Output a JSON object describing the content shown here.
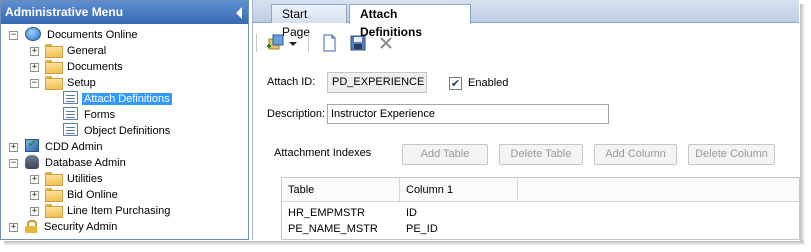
{
  "left_panel": {
    "title": "Administrative Menu",
    "tree": [
      {
        "label": "Documents Online",
        "icon": "globe-icon",
        "expander": "-"
      },
      {
        "label": "General",
        "icon": "folder-icon",
        "expander": "+"
      },
      {
        "label": "Documents",
        "icon": "folder-icon",
        "expander": "+"
      },
      {
        "label": "Setup",
        "icon": "folder-open-icon",
        "expander": "-"
      },
      {
        "label": "Attach Definitions",
        "icon": "definition-icon",
        "selected": true
      },
      {
        "label": "Forms",
        "icon": "form-icon"
      },
      {
        "label": "Object Definitions",
        "icon": "object-definition-icon"
      },
      {
        "label": "CDD Admin",
        "icon": "cdd-icon",
        "expander": "+"
      },
      {
        "label": "Database Admin",
        "icon": "database-icon",
        "expander": "-"
      },
      {
        "label": "Utilities",
        "icon": "folder-icon",
        "expander": "+"
      },
      {
        "label": "Bid Online",
        "icon": "folder-icon",
        "expander": "+"
      },
      {
        "label": "Line Item Purchasing",
        "icon": "folder-icon",
        "expander": "+"
      },
      {
        "label": "Security Admin",
        "icon": "lock-icon",
        "expander": "+"
      }
    ]
  },
  "tabs": [
    {
      "label": "Start Page",
      "active": false
    },
    {
      "label": "Attach Definitions",
      "active": true
    }
  ],
  "form": {
    "attach_id_label": "Attach ID:",
    "attach_id_value": "PD_EXPERIENCE",
    "enabled_label": "Enabled",
    "enabled_checked": true,
    "description_label": "Description:",
    "description_value": "Instructor Experience",
    "indexes_label": "Attachment Indexes",
    "buttons": {
      "add_table": "Add Table",
      "delete_table": "Delete Table",
      "add_column": "Add Column",
      "delete_column": "Delete Column"
    }
  },
  "grid": {
    "columns": [
      "Table",
      "Column 1"
    ],
    "rows": [
      [
        "HR_EMPMSTR",
        "ID"
      ],
      [
        "PE_NAME_MSTR",
        "PE_ID"
      ]
    ]
  },
  "colors": {
    "header_blue": "#3769b5",
    "selection": "#3399ff"
  }
}
